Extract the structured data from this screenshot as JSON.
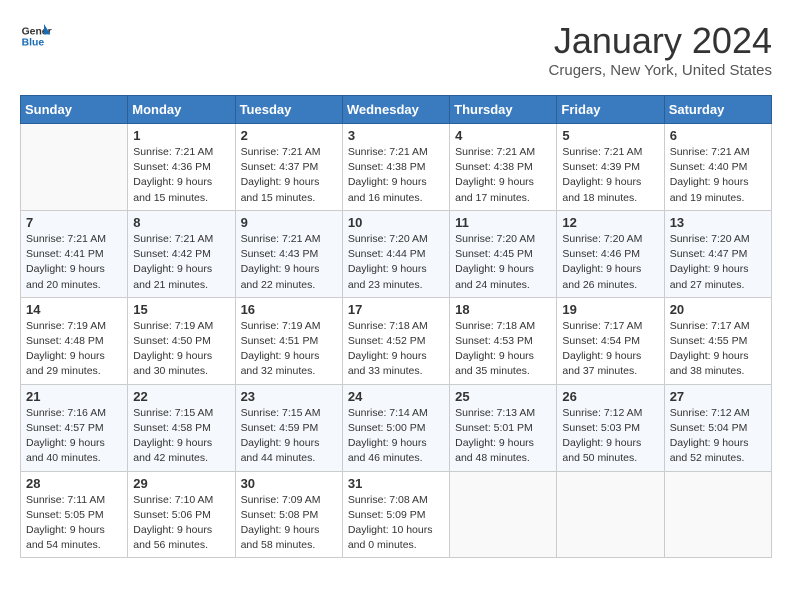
{
  "header": {
    "logo_general": "General",
    "logo_blue": "Blue",
    "title": "January 2024",
    "subtitle": "Crugers, New York, United States"
  },
  "calendar": {
    "days_of_week": [
      "Sunday",
      "Monday",
      "Tuesday",
      "Wednesday",
      "Thursday",
      "Friday",
      "Saturday"
    ],
    "weeks": [
      [
        {
          "day": "",
          "info": ""
        },
        {
          "day": "1",
          "info": "Sunrise: 7:21 AM\nSunset: 4:36 PM\nDaylight: 9 hours\nand 15 minutes."
        },
        {
          "day": "2",
          "info": "Sunrise: 7:21 AM\nSunset: 4:37 PM\nDaylight: 9 hours\nand 15 minutes."
        },
        {
          "day": "3",
          "info": "Sunrise: 7:21 AM\nSunset: 4:38 PM\nDaylight: 9 hours\nand 16 minutes."
        },
        {
          "day": "4",
          "info": "Sunrise: 7:21 AM\nSunset: 4:38 PM\nDaylight: 9 hours\nand 17 minutes."
        },
        {
          "day": "5",
          "info": "Sunrise: 7:21 AM\nSunset: 4:39 PM\nDaylight: 9 hours\nand 18 minutes."
        },
        {
          "day": "6",
          "info": "Sunrise: 7:21 AM\nSunset: 4:40 PM\nDaylight: 9 hours\nand 19 minutes."
        }
      ],
      [
        {
          "day": "7",
          "info": "Sunrise: 7:21 AM\nSunset: 4:41 PM\nDaylight: 9 hours\nand 20 minutes."
        },
        {
          "day": "8",
          "info": "Sunrise: 7:21 AM\nSunset: 4:42 PM\nDaylight: 9 hours\nand 21 minutes."
        },
        {
          "day": "9",
          "info": "Sunrise: 7:21 AM\nSunset: 4:43 PM\nDaylight: 9 hours\nand 22 minutes."
        },
        {
          "day": "10",
          "info": "Sunrise: 7:20 AM\nSunset: 4:44 PM\nDaylight: 9 hours\nand 23 minutes."
        },
        {
          "day": "11",
          "info": "Sunrise: 7:20 AM\nSunset: 4:45 PM\nDaylight: 9 hours\nand 24 minutes."
        },
        {
          "day": "12",
          "info": "Sunrise: 7:20 AM\nSunset: 4:46 PM\nDaylight: 9 hours\nand 26 minutes."
        },
        {
          "day": "13",
          "info": "Sunrise: 7:20 AM\nSunset: 4:47 PM\nDaylight: 9 hours\nand 27 minutes."
        }
      ],
      [
        {
          "day": "14",
          "info": "Sunrise: 7:19 AM\nSunset: 4:48 PM\nDaylight: 9 hours\nand 29 minutes."
        },
        {
          "day": "15",
          "info": "Sunrise: 7:19 AM\nSunset: 4:50 PM\nDaylight: 9 hours\nand 30 minutes."
        },
        {
          "day": "16",
          "info": "Sunrise: 7:19 AM\nSunset: 4:51 PM\nDaylight: 9 hours\nand 32 minutes."
        },
        {
          "day": "17",
          "info": "Sunrise: 7:18 AM\nSunset: 4:52 PM\nDaylight: 9 hours\nand 33 minutes."
        },
        {
          "day": "18",
          "info": "Sunrise: 7:18 AM\nSunset: 4:53 PM\nDaylight: 9 hours\nand 35 minutes."
        },
        {
          "day": "19",
          "info": "Sunrise: 7:17 AM\nSunset: 4:54 PM\nDaylight: 9 hours\nand 37 minutes."
        },
        {
          "day": "20",
          "info": "Sunrise: 7:17 AM\nSunset: 4:55 PM\nDaylight: 9 hours\nand 38 minutes."
        }
      ],
      [
        {
          "day": "21",
          "info": "Sunrise: 7:16 AM\nSunset: 4:57 PM\nDaylight: 9 hours\nand 40 minutes."
        },
        {
          "day": "22",
          "info": "Sunrise: 7:15 AM\nSunset: 4:58 PM\nDaylight: 9 hours\nand 42 minutes."
        },
        {
          "day": "23",
          "info": "Sunrise: 7:15 AM\nSunset: 4:59 PM\nDaylight: 9 hours\nand 44 minutes."
        },
        {
          "day": "24",
          "info": "Sunrise: 7:14 AM\nSunset: 5:00 PM\nDaylight: 9 hours\nand 46 minutes."
        },
        {
          "day": "25",
          "info": "Sunrise: 7:13 AM\nSunset: 5:01 PM\nDaylight: 9 hours\nand 48 minutes."
        },
        {
          "day": "26",
          "info": "Sunrise: 7:12 AM\nSunset: 5:03 PM\nDaylight: 9 hours\nand 50 minutes."
        },
        {
          "day": "27",
          "info": "Sunrise: 7:12 AM\nSunset: 5:04 PM\nDaylight: 9 hours\nand 52 minutes."
        }
      ],
      [
        {
          "day": "28",
          "info": "Sunrise: 7:11 AM\nSunset: 5:05 PM\nDaylight: 9 hours\nand 54 minutes."
        },
        {
          "day": "29",
          "info": "Sunrise: 7:10 AM\nSunset: 5:06 PM\nDaylight: 9 hours\nand 56 minutes."
        },
        {
          "day": "30",
          "info": "Sunrise: 7:09 AM\nSunset: 5:08 PM\nDaylight: 9 hours\nand 58 minutes."
        },
        {
          "day": "31",
          "info": "Sunrise: 7:08 AM\nSunset: 5:09 PM\nDaylight: 10 hours\nand 0 minutes."
        },
        {
          "day": "",
          "info": ""
        },
        {
          "day": "",
          "info": ""
        },
        {
          "day": "",
          "info": ""
        }
      ]
    ]
  }
}
